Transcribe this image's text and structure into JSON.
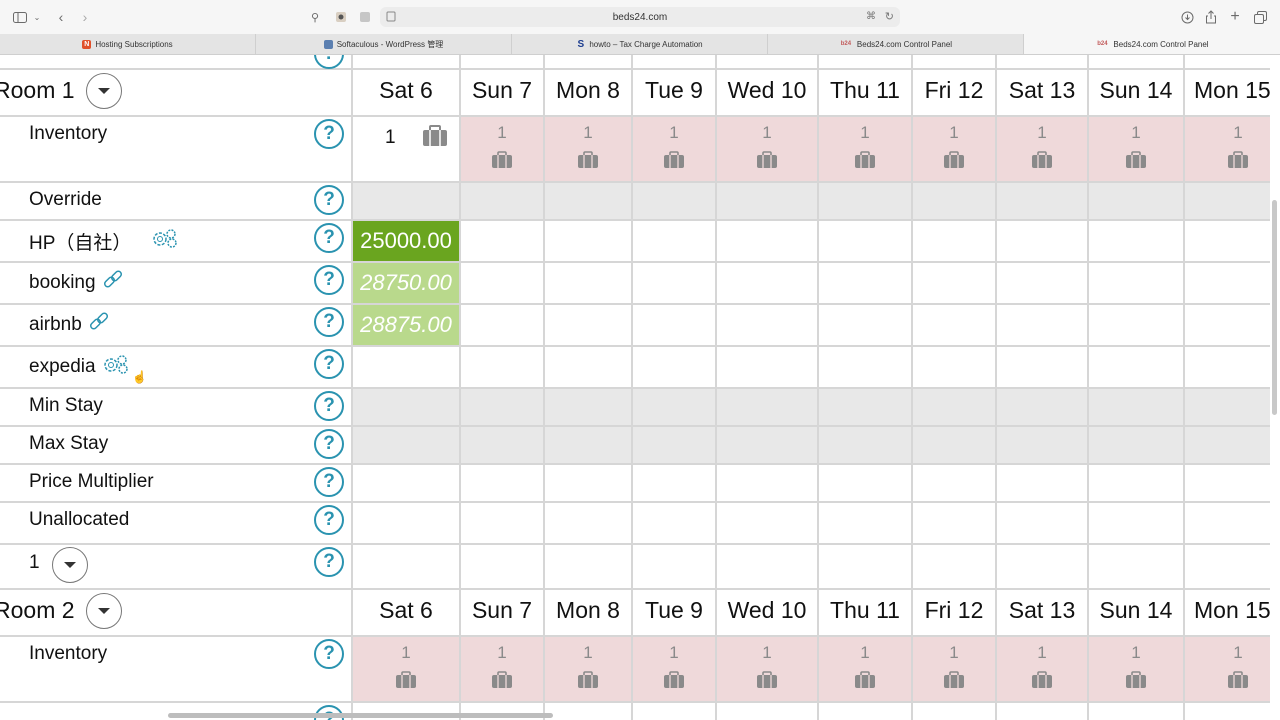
{
  "browser": {
    "url": "beds24.com",
    "tabs": [
      {
        "title": "Hosting Subscriptions",
        "icon": "hosting-icon",
        "color": "#e0502a"
      },
      {
        "title": "Softaculous - WordPress 管理",
        "icon": "softaculous-icon",
        "color": "#5b7fb0"
      },
      {
        "title": "howto – Tax Charge Automation",
        "icon": "s-logo-icon",
        "color": "#1c3d8f"
      },
      {
        "title": "Beds24.com Control Panel",
        "icon": "beds24-icon",
        "color": "#c25a5a"
      },
      {
        "title": "Beds24.com Control Panel",
        "icon": "beds24-icon",
        "color": "#c25a5a"
      }
    ]
  },
  "days": [
    "Sat 6",
    "Sun 7",
    "Mon 8",
    "Tue 9",
    "Wed 10",
    "Thu 11",
    "Fri 12",
    "Sat 13",
    "Sun 14",
    "Mon 15"
  ],
  "room1": {
    "title": "Room 1",
    "inventory_label": "Inventory",
    "inventory_first": "1",
    "inventory_values": [
      "1",
      "1",
      "1",
      "1",
      "1",
      "1",
      "1",
      "1",
      "1"
    ],
    "rows": {
      "override": "Override",
      "hp": "HP（自社）",
      "booking": "booking",
      "airbnb": "airbnb",
      "expedia": "expedia",
      "min_stay": "Min Stay",
      "max_stay": "Max Stay",
      "price_multiplier": "Price Multiplier",
      "unallocated": "Unallocated",
      "unit": "1"
    },
    "prices": {
      "hp": "25000.00",
      "booking": "28750.00",
      "airbnb": "28875.00"
    }
  },
  "room2": {
    "title": "Room 2",
    "inventory_label": "Inventory",
    "inventory_values": [
      "1",
      "1",
      "1",
      "1",
      "1",
      "1",
      "1",
      "1",
      "1",
      "1"
    ]
  },
  "colors": {
    "help": "#2a93b0",
    "hp_price_bg": "#6aa51f",
    "channel_price_bg": "#b9d98c",
    "unavailable_bg": "#efd9da",
    "disabled_bg": "#e8e8e8"
  }
}
